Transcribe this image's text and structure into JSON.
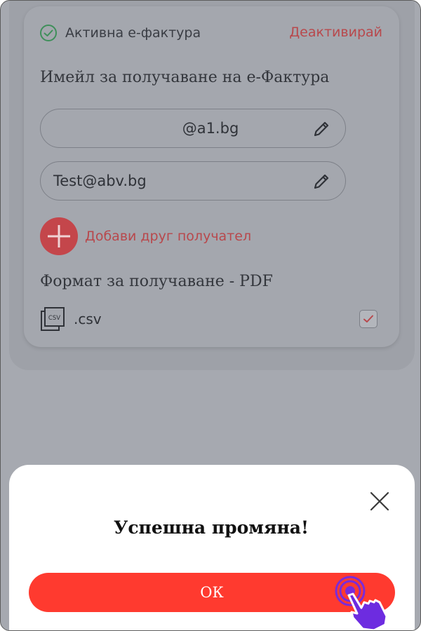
{
  "einvoice": {
    "status_label": "Активна е-фактура",
    "deactivate_label": "Деактивирай",
    "email_section_title": "Имейл за получаване на е-Фактура",
    "emails": [
      {
        "value": "@a1.bg"
      },
      {
        "value": "Test@abv.bg"
      }
    ],
    "add_recipient_label": "Добави друг получател",
    "format_title": "Формат за получаване - PDF",
    "csv_label": ".csv",
    "csv_icon_text": "CSV",
    "csv_checked": true
  },
  "dialog": {
    "title": "Успешна промяна!",
    "ok_label": "ОК"
  },
  "colors": {
    "accent_red": "#ff3a2f",
    "link_red": "#b8484c",
    "success_green": "#3f8f5a",
    "overlay_gray": "#a6a9b0"
  },
  "icons": [
    "check-circle-icon",
    "pencil-icon",
    "plus-icon",
    "csv-file-icon",
    "checkmark-icon",
    "close-icon",
    "tap-hand-icon"
  ]
}
